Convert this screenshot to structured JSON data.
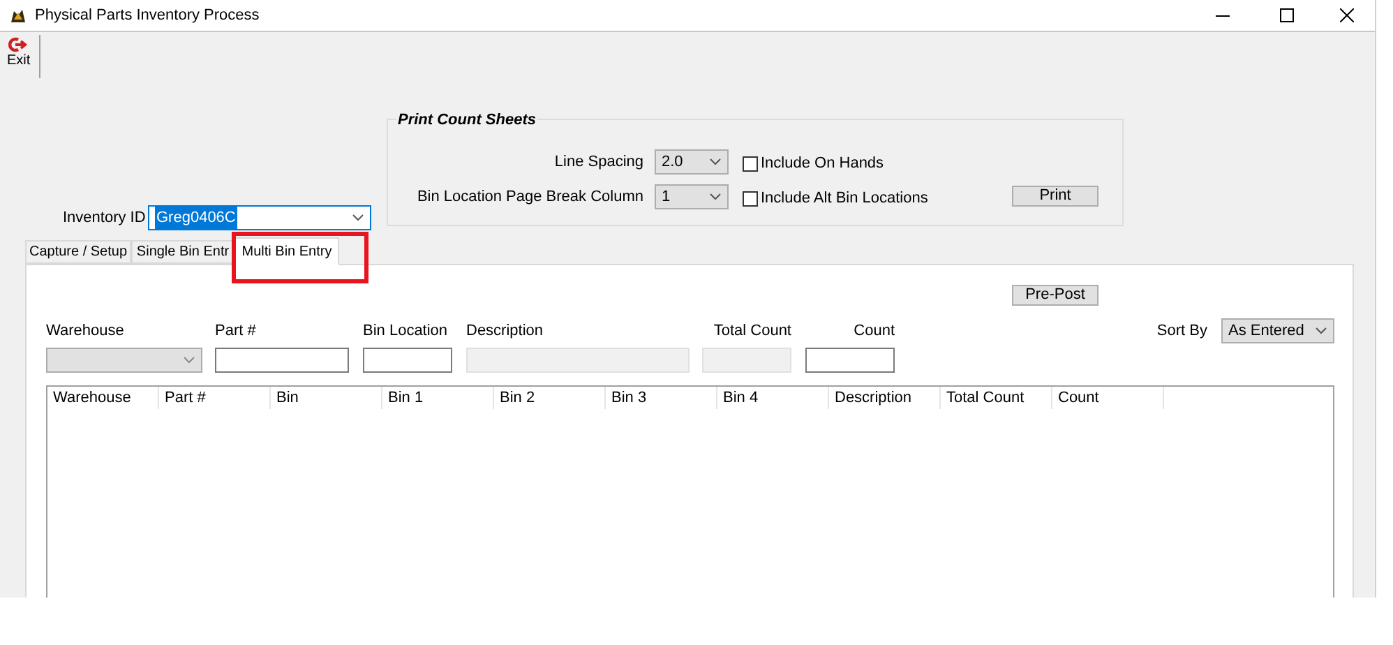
{
  "window": {
    "title": "Physical Parts Inventory Process"
  },
  "toolbar": {
    "exit_label": "Exit"
  },
  "print_count_sheets": {
    "title": "Print Count Sheets",
    "line_spacing_label": "Line Spacing",
    "line_spacing_value": "2.0",
    "page_break_label": "Bin Location Page Break Column",
    "page_break_value": "1",
    "options": [
      {
        "label": "Include On Hands",
        "checked": false
      },
      {
        "label": "Include Alt Bin Locations",
        "checked": false
      }
    ],
    "print_button": "Print"
  },
  "inventory_id": {
    "label": "Inventory ID",
    "value": "Greg0406C"
  },
  "tabs": [
    {
      "label": "Capture / Setup",
      "selected": false
    },
    {
      "label": "Single Bin Entr",
      "selected": false
    },
    {
      "label": "Multi Bin Entry",
      "selected": true
    }
  ],
  "pre_post_button": "Pre-Post",
  "entry_fields": [
    {
      "label": "Warehouse",
      "kind": "combo",
      "disabled": true
    },
    {
      "label": "Part #",
      "kind": "text",
      "disabled": false
    },
    {
      "label": "Bin Location",
      "kind": "text",
      "disabled": false
    },
    {
      "label": "Description",
      "kind": "text",
      "disabled": true
    },
    {
      "label": "Total Count",
      "kind": "text",
      "disabled": true
    },
    {
      "label": "Count",
      "kind": "text",
      "disabled": false
    }
  ],
  "sort_by": {
    "label": "Sort By",
    "value": "As Entered"
  },
  "table": {
    "columns": [
      "Warehouse",
      "Part #",
      "Bin",
      "Bin 1",
      "Bin 2",
      "Bin 3",
      "Bin 4",
      "Description",
      "Total Count",
      "Count"
    ]
  }
}
